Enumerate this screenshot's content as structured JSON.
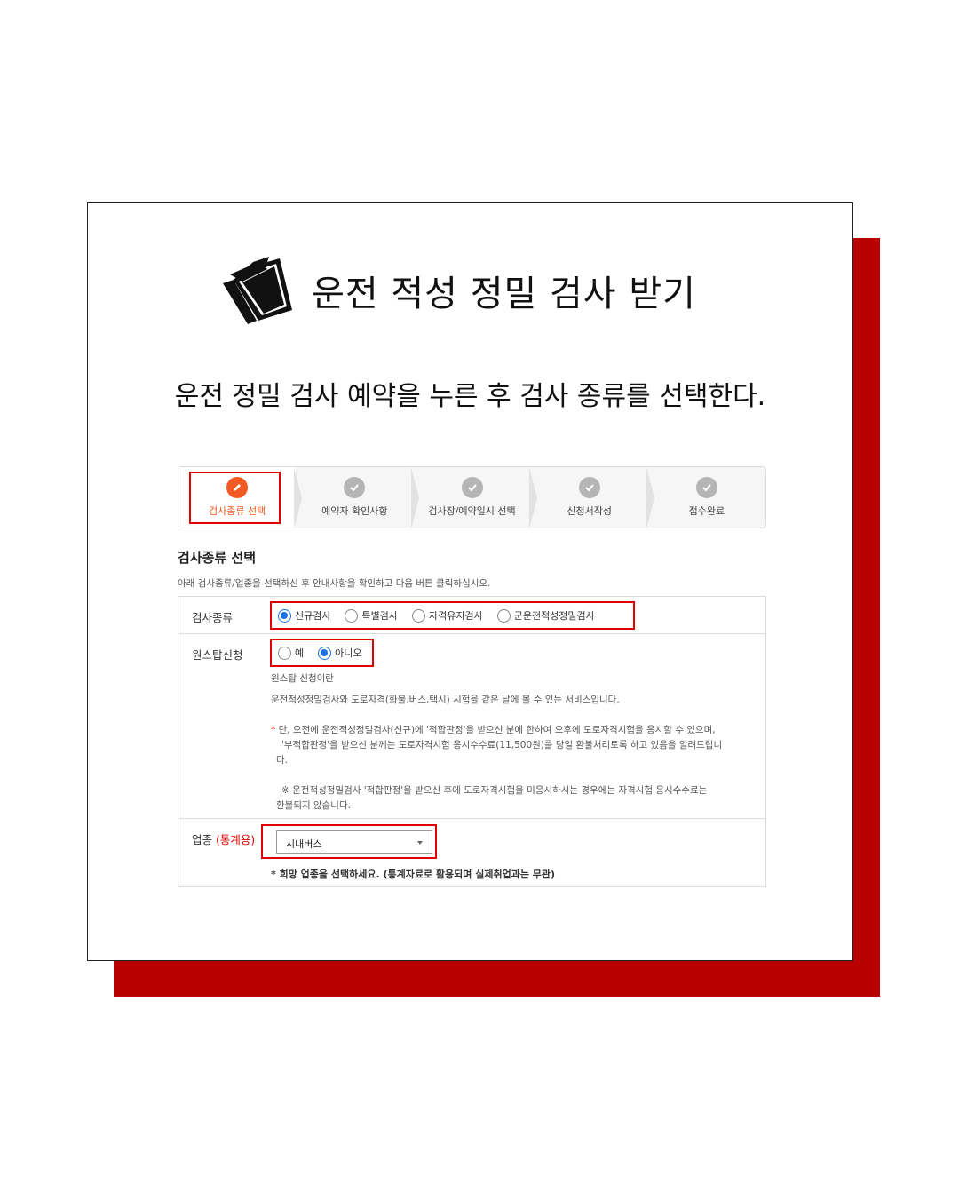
{
  "title": "운전 적성 정밀 검사 받기",
  "subtitle": "운전 정밀 검사 예약을 누른 후 검사 종류를 선택한다.",
  "steps": [
    {
      "label": "검사종류 선택",
      "active": true
    },
    {
      "label": "예약자 확인사항",
      "active": false
    },
    {
      "label": "검사장/예약일시 선택",
      "active": false
    },
    {
      "label": "신청서작성",
      "active": false
    },
    {
      "label": "접수완료",
      "active": false
    }
  ],
  "section": {
    "title": "검사종류 선택",
    "desc": "아래 검사종류/업종을 선택하신 후 안내사항을 확인하고 다음 버튼 클릭하십시오."
  },
  "exam_type": {
    "label": "검사종류",
    "options": [
      "신규검사",
      "특별검사",
      "자격유지검사",
      "군운전적성정밀검사"
    ],
    "selected": "신규검사"
  },
  "onestop": {
    "label": "원스탑신청",
    "options": [
      "예",
      "아니오"
    ],
    "selected": "아니오",
    "info_title": "원스탑 신청이란",
    "info_desc": "운전적성정밀검사와 도로자격(화물,버스,택시) 시험을 같은 날에 볼 수 있는 서비스입니다.",
    "note_line1": "단, 오전에 운전적성정밀검사(신규)에 '적합판정'을 받으신 분에 한하여 오후에 도로자격시험을 응시할 수 있으며,",
    "note_line2": "'부적합판정'을 받으신 분께는 도로자격시험 응시수수료(11,500원)를 당일 환불처리토록 하고 있음을 알려드립니",
    "note_line3": "다.",
    "sub_note_line1": "※ 운전적성정밀검사 '적합판정'을 받으신 후에 도로자격시험을 미응시하시는 경우에는 자격시험 응시수수료는",
    "sub_note_line2": "환불되지 않습니다."
  },
  "industry": {
    "label": "업종",
    "tag": "(통계용)",
    "selected": "시내버스",
    "note": "* 희망 업종을 선택하세요. (통계자료로 활용되며 실제취업과는 무관)"
  },
  "colors": {
    "accent_red": "#e10000",
    "brand_red": "#b80000",
    "active_orange": "#f15a22",
    "radio_blue": "#1a73e8"
  }
}
